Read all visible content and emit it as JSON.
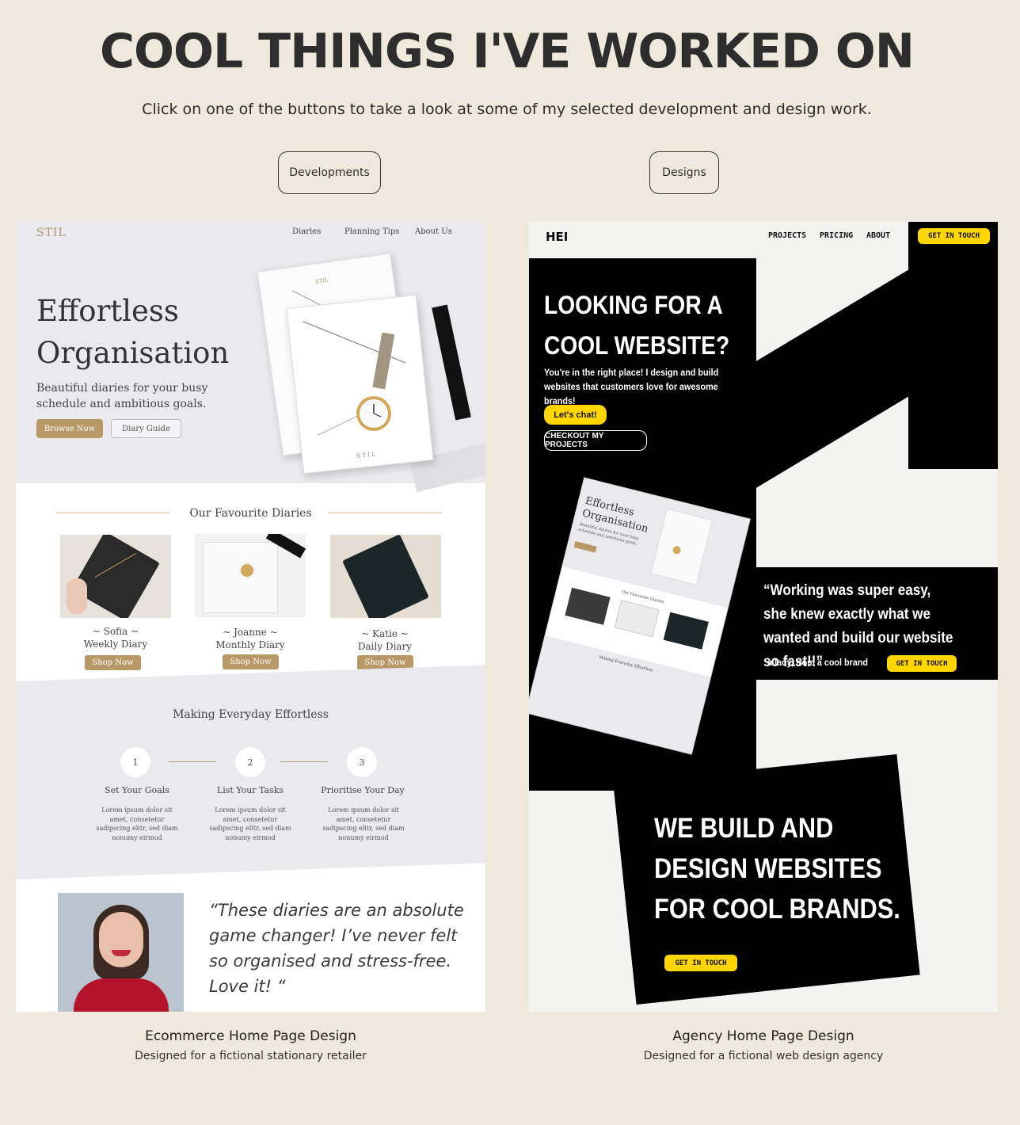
{
  "header": {
    "title": "COOL THINGS I'VE WORKED ON",
    "subtitle": "Click on one of the buttons to take a look at some of my selected development and design work."
  },
  "filters": {
    "developments_label": "Developments",
    "designs_label": "Designs"
  },
  "projects": [
    {
      "title": "Ecommerce Home Page Design",
      "description": "Designed for a fictional stationary retailer",
      "mock": {
        "logo": "STIL",
        "nav": [
          "Diaries",
          "Planning Tips",
          "About Us"
        ],
        "hero_title": "Effortless Organisation",
        "hero_tagline": "Beautiful diaries for your busy schedule and ambitious goals.",
        "primary_button": "Browse Now",
        "secondary_button": "Diary Guide",
        "notebook_brand": "STIL",
        "favourites_title": "Our Favourite Diaries",
        "products": [
          {
            "name": "~ Sofia ~",
            "type": "Weekly Diary",
            "button": "Shop Now"
          },
          {
            "name": "~ Joanne ~",
            "type": "Monthly Diary",
            "button": "Shop Now"
          },
          {
            "name": "~ Katie ~",
            "type": "Daily Diary",
            "button": "Shop Now"
          }
        ],
        "steps_title": "Making Everyday Effortless",
        "steps": [
          {
            "number": "1",
            "title": "Set Your Goals",
            "body": "Lorem ipsum dolor sit amet, consetetur sadipscing elitr, sed diam nonumy eirmod"
          },
          {
            "number": "2",
            "title": "List Your Tasks",
            "body": "Lorem ipsum dolor sit amet, consetetur sadipscing elitr, sed diam nonumy eirmod"
          },
          {
            "number": "3",
            "title": "Prioritise Your Day",
            "body": "Lorem ipsum dolor sit amet, consetetur sadipscing elitr, sed diam nonumy eirmod"
          }
        ],
        "testimonial": "“These diaries are an absolute game changer! I’ve never felt so organised and stress-free. Love it! “"
      }
    },
    {
      "title": "Agency Home Page Design",
      "description": "Designed for a fictional web design agency",
      "mock": {
        "logo": "HEI",
        "nav": [
          "PROJECTS",
          "PRICING",
          "ABOUT"
        ],
        "nav_cta": "GET IN TOUCH",
        "hero_title": "LOOKING FOR A COOL WEBSITE?",
        "hero_lead": "You're in the right place! I design and build websites that customers love for awesome brands!",
        "chat_button": "Let's chat!",
        "projects_button": "CHECKOUT MY PROJECTS",
        "testimonial": "“Working was super easy, she knew exactly what we wanted and build our website so fast!!”",
        "testimonial_by": "a lady, from a cool brand",
        "testimonial_cta": "GET IN TOUCH",
        "tagline": "WE BUILD AND DESIGN WEBSITES FOR COOL BRANDS.",
        "bottom_cta": "GET IN TOUCH",
        "mini_preview": {
          "hero_title": "Effortless Organisation",
          "hero_tagline": "Beautiful diaries for your busy schedule and ambitious goals.",
          "favourites_title": "Our Favourite Diaries",
          "steps_title": "Making Everyday Effortless"
        }
      }
    }
  ],
  "colors": {
    "page_background": "#efe8dc",
    "stil_gold": "#b79866",
    "stil_grey": "#e9e9ee",
    "hei_yellow": "#ffd500",
    "hei_black": "#000000"
  },
  "icons": [
    "watch-icon",
    "notebook-icon"
  ]
}
